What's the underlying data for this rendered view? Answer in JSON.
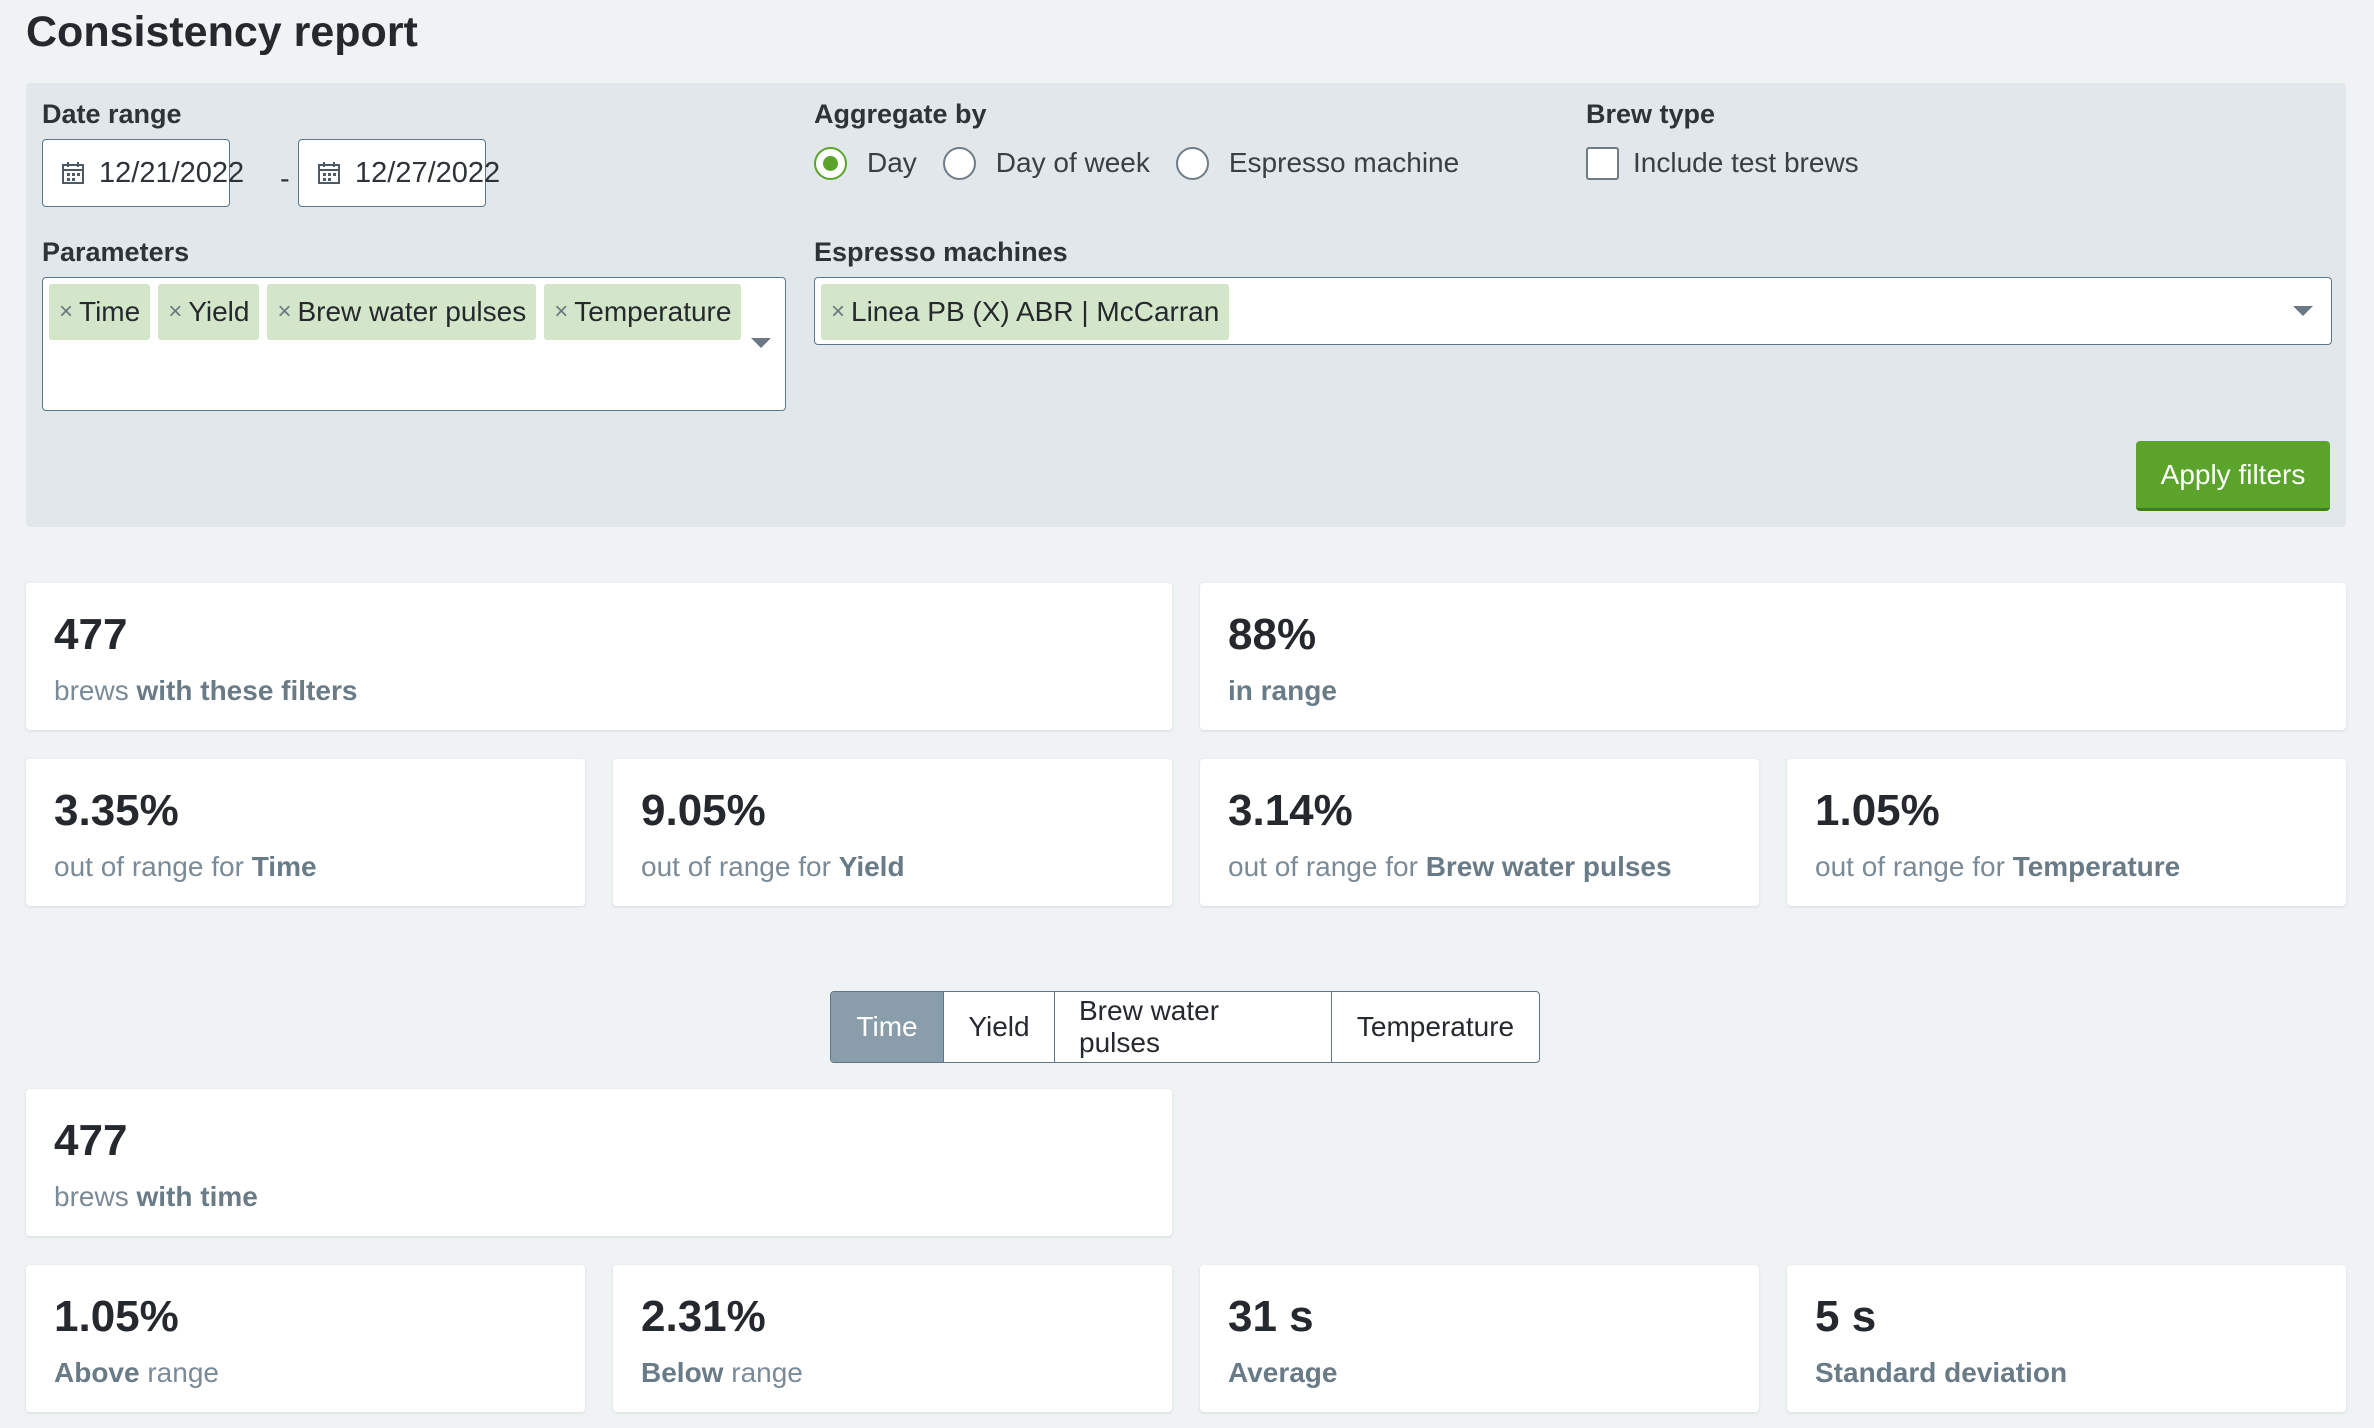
{
  "page": {
    "title": "Consistency report"
  },
  "filters": {
    "date_range": {
      "label": "Date range",
      "start": "12/21/2022",
      "separator": "-",
      "end": "12/27/2022"
    },
    "aggregate_by": {
      "label": "Aggregate by",
      "options": [
        "Day",
        "Day of week",
        "Espresso machine"
      ],
      "selected": "Day"
    },
    "brew_type": {
      "label": "Brew type",
      "include_test_brews": "Include test brews",
      "checked": false
    },
    "parameters": {
      "label": "Parameters",
      "tags": [
        "Time",
        "Yield",
        "Brew water pulses",
        "Temperature"
      ]
    },
    "espresso_machines": {
      "label": "Espresso machines",
      "tags": [
        "Linea PB (X) ABR | McCarran"
      ]
    },
    "remove_symbol": "×",
    "apply_label": "Apply filters"
  },
  "summary": {
    "brews": {
      "value": "477",
      "text": "brews",
      "bold": "with these filters"
    },
    "in_range": {
      "value": "88%",
      "bold": "in range"
    },
    "out_of_range_prefix": "out of range for",
    "out_of_range": [
      {
        "value": "3.35%",
        "param": "Time"
      },
      {
        "value": "9.05%",
        "param": "Yield"
      },
      {
        "value": "3.14%",
        "param": "Brew water pulses"
      },
      {
        "value": "1.05%",
        "param": "Temperature"
      }
    ]
  },
  "tabs": {
    "items": [
      "Time",
      "Yield",
      "Brew water pulses",
      "Temperature"
    ],
    "active": "Time"
  },
  "detail": {
    "brews": {
      "value": "477",
      "text": "brews",
      "bold": "with time"
    },
    "above": {
      "value": "1.05%",
      "bold": "Above",
      "text": "range"
    },
    "below": {
      "value": "2.31%",
      "bold": "Below",
      "text": "range"
    },
    "average": {
      "value": "31 s",
      "bold": "Average"
    },
    "std_dev": {
      "value": "5 s",
      "bold": "Standard deviation"
    }
  },
  "colors": {
    "accent": "#5ba32b",
    "tag_bg": "#d4e6c9",
    "active_tab": "#8a9dab",
    "border": "#5b7789"
  }
}
